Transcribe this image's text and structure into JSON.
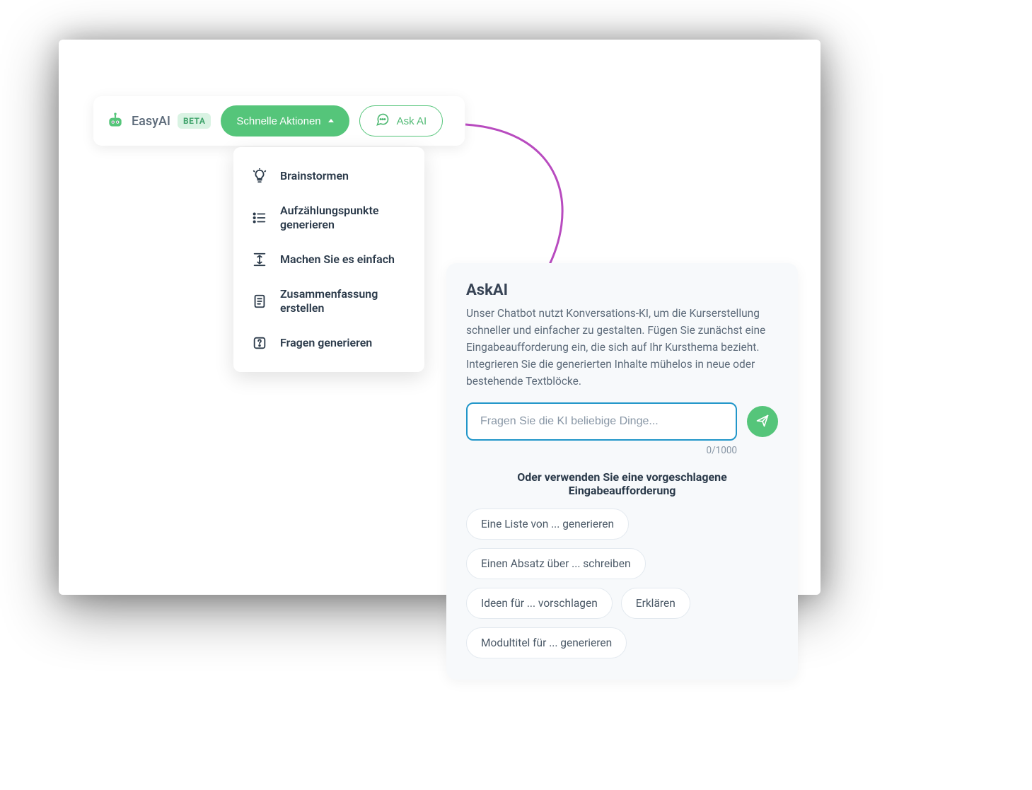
{
  "toolbar": {
    "brand": "EasyAI",
    "beta": "BETA",
    "quick_actions_label": "Schnelle Aktionen",
    "ask_ai_label": "Ask AI"
  },
  "dropdown": {
    "items": [
      {
        "label": "Brainstormen"
      },
      {
        "label": "Aufzählungspunkte generieren"
      },
      {
        "label": "Machen Sie es einfach"
      },
      {
        "label": "Zusammenfassung erstellen"
      },
      {
        "label": "Fragen generieren"
      }
    ]
  },
  "panel": {
    "title": "AskAI",
    "description": "Unser Chatbot nutzt Konversations-KI, um die Kurserstellung schneller und einfacher zu gestalten. Fügen Sie zunächst eine Eingabeaufforderung ein, die sich auf Ihr Kursthema bezieht. Integrieren Sie die generierten Inhalte mühelos in neue oder bestehende Textblöcke.",
    "placeholder": "Fragen Sie die KI beliebige Dinge...",
    "char_count": "0/1000",
    "suggest_heading": "Oder verwenden Sie eine vorgeschlagene Eingabeaufforderung",
    "suggestions": [
      "Eine Liste von ... generieren",
      "Einen Absatz über ... schreiben",
      "Ideen für ... vorschlagen",
      "Erklären",
      "Modultitel für ... generieren"
    ]
  }
}
